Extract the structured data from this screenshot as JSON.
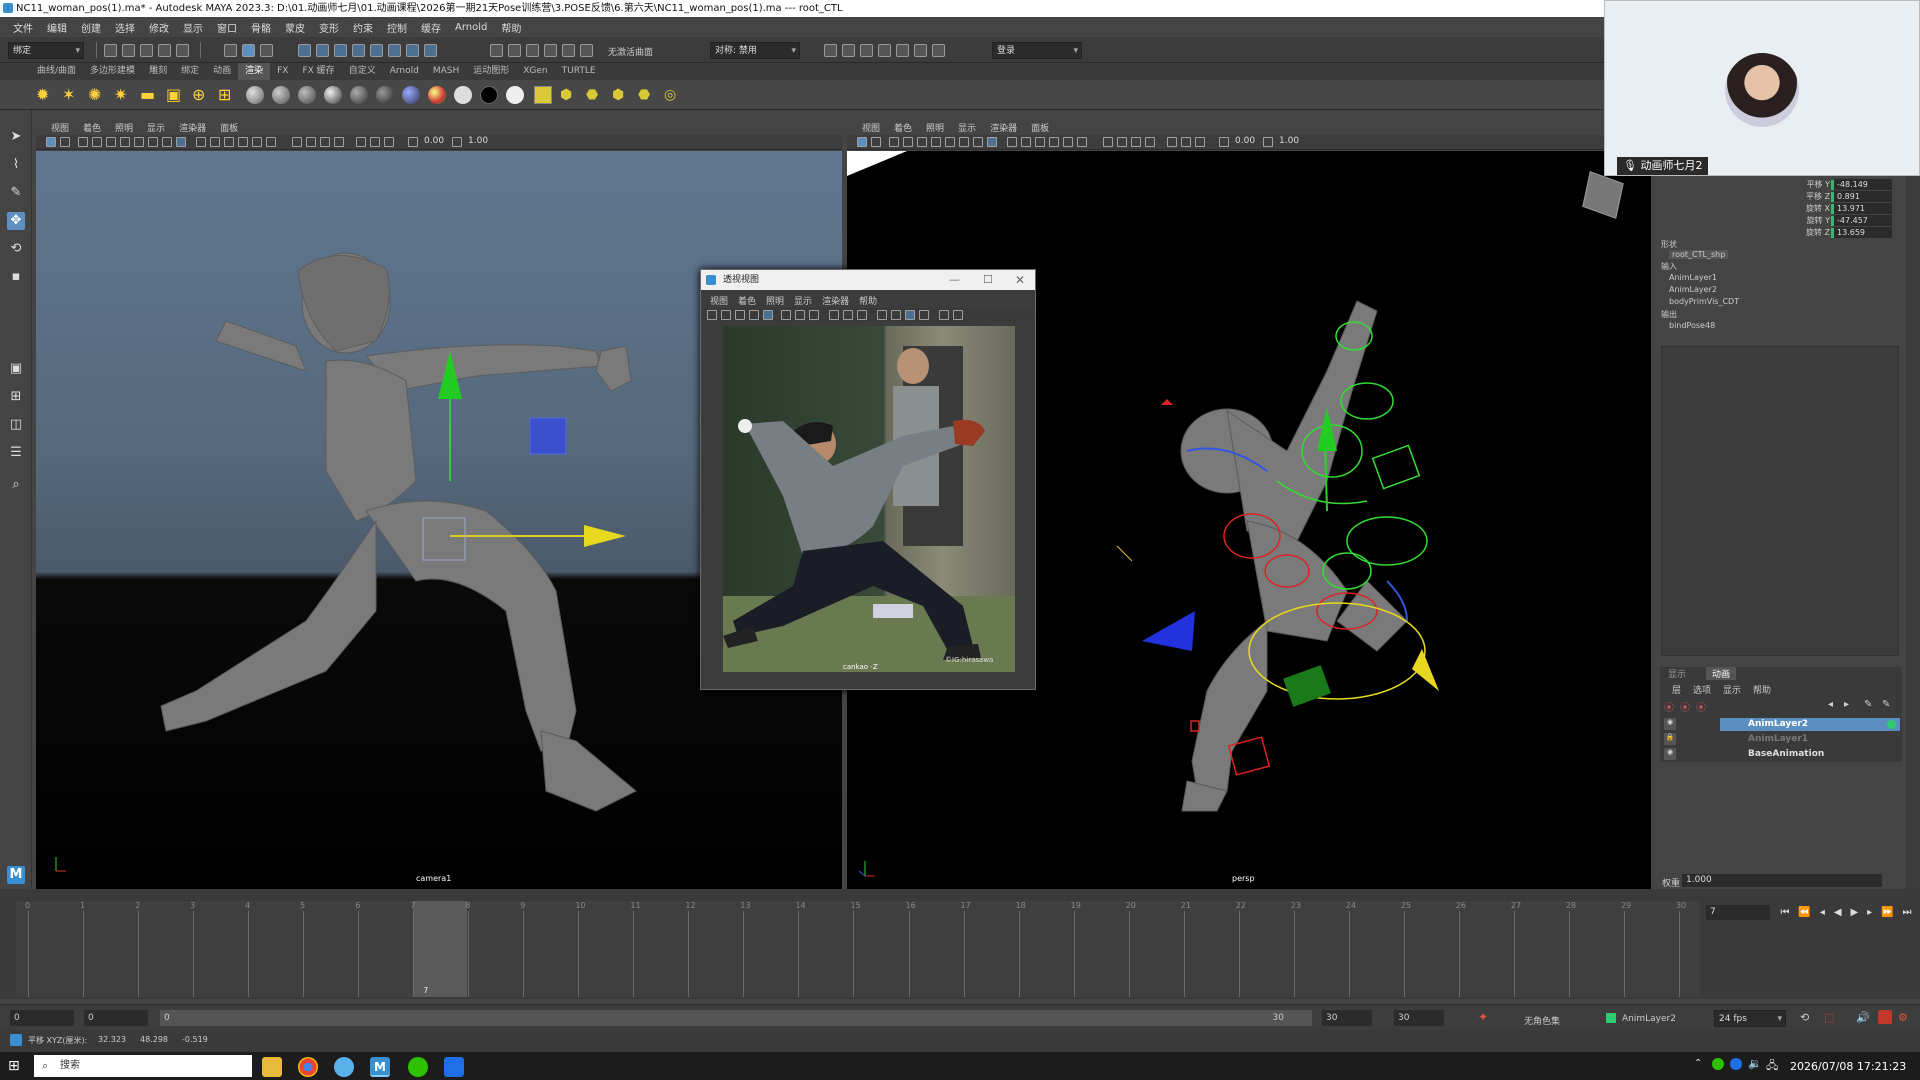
{
  "window": {
    "title": "NC11_woman_pos(1).ma* - Autodesk MAYA 2023.3: D:\\01.动画师七月\\01.动画课程\\2026第一期21天Pose训练营\\3.POSE反馈\\6.第六天\\NC11_woman_pos(1).ma   ---   root_CTL"
  },
  "menubar": [
    "文件",
    "编辑",
    "创建",
    "选择",
    "修改",
    "显示",
    "窗口",
    "骨骼",
    "蒙皮",
    "变形",
    "约束",
    "控制",
    "缓存",
    "Arnold",
    "帮助"
  ],
  "statusline": {
    "mode": "绑定",
    "surface": "无激活曲面",
    "symmetry": "对称: 禁用",
    "login": "登录"
  },
  "shelf_tabs": [
    "曲线/曲面",
    "多边形建模",
    "雕刻",
    "绑定",
    "动画",
    "渲染",
    "FX",
    "FX 缓存",
    "自定义",
    "Arnold",
    "MASH",
    "运动图形",
    "XGen",
    "TURTLE"
  ],
  "shelf_active": "渲染",
  "viewport_menu": [
    "视图",
    "着色",
    "照明",
    "显示",
    "渲染器",
    "面板"
  ],
  "viewport_left": {
    "camera": "camera1",
    "val_a": "0.00",
    "val_b": "1.00"
  },
  "viewport_right": {
    "camera": "persp",
    "val_a": "0.00",
    "val_b": "1.00"
  },
  "float_panel": {
    "title": "透视视图",
    "menu": [
      "视图",
      "着色",
      "照明",
      "显示",
      "渲染器",
      "帮助"
    ],
    "camera": "cankao -Z",
    "watermark": "©IG:hirasawa"
  },
  "webcam": {
    "name": "动画师七月2"
  },
  "channelbox": {
    "attrs": [
      {
        "name": "平移 Y",
        "value": "-48.149"
      },
      {
        "name": "平移 Z",
        "value": "0.891"
      },
      {
        "name": "旋转 X",
        "value": "13.971"
      },
      {
        "name": "旋转 Y",
        "value": "-47.457"
      },
      {
        "name": "旋转 Z",
        "value": "13.659"
      }
    ],
    "shapes_label": "形状",
    "shape": "root_CTL_shp",
    "inputs_label": "输入",
    "inputs": [
      "AnimLayer1",
      "AnimLayer2",
      "bodyPrimVis_CDT"
    ],
    "outputs_label": "输出",
    "outputs": [
      "bindPose48"
    ]
  },
  "layer_editor": {
    "tabs": [
      "显示",
      "动画"
    ],
    "menu": [
      "层",
      "选项",
      "显示",
      "帮助"
    ],
    "layers": [
      "AnimLayer2",
      "AnimLayer1",
      "BaseAnimation"
    ],
    "weight_label": "权重",
    "weight": "1.000"
  },
  "timeline": {
    "ticks": [
      "0",
      "1",
      "2",
      "3",
      "4",
      "5",
      "6",
      "7",
      "8",
      "9",
      "10",
      "11",
      "12",
      "13",
      "14",
      "15",
      "16",
      "17",
      "18",
      "19",
      "20",
      "21",
      "22",
      "23",
      "24",
      "25",
      "26",
      "27",
      "28",
      "29",
      "30"
    ],
    "current": "7",
    "current_field": "7"
  },
  "range": {
    "start": "0",
    "anim_start": "0",
    "slider_start": "0",
    "slider_end": "30",
    "end": "30",
    "anim_end": "30",
    "character_set": "无角色集",
    "layer": "AnimLayer2",
    "fps": "24 fps"
  },
  "cmdline": {
    "text": "平移 XYZ(厘米):",
    "x": "32.323",
    "y": "48.298",
    "z": "-0.519"
  },
  "taskbar": {
    "search": "搜索",
    "clock": "2026/07/08 17:21:23"
  }
}
